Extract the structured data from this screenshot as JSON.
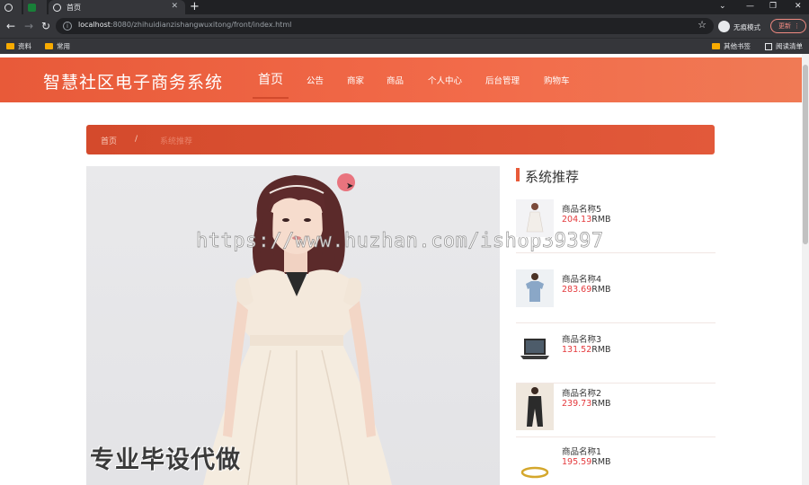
{
  "browser": {
    "tabs": [
      {
        "label": ""
      },
      {
        "label": ""
      },
      {
        "label": "首页"
      }
    ],
    "url_host": "localhost",
    "url_rest": ":8080/zhihuidianzishangwuxitong/front/index.html",
    "incognito_label": "无痕模式",
    "update_label": "更新",
    "bookmarks": [
      {
        "label": "资料"
      },
      {
        "label": "常用"
      }
    ],
    "other_bookmarks": "其他书签",
    "reading_list": "阅读清单"
  },
  "site": {
    "title": "智慧社区电子商务系统",
    "nav": [
      {
        "label": "首页",
        "active": true
      },
      {
        "label": "公告"
      },
      {
        "label": "商家"
      },
      {
        "label": "商品"
      },
      {
        "label": "个人中心"
      },
      {
        "label": "后台管理"
      },
      {
        "label": "购物车"
      }
    ],
    "breadcrumb": {
      "home": "首页",
      "separator": "/",
      "current": "系统推荐"
    },
    "hero_overlay": "专业毕设代做",
    "watermark": "https://www.huzhan.com/ishop39397",
    "recommend": {
      "title": "系统推荐",
      "items": [
        {
          "name": "商品名称5",
          "price": "204.13",
          "unit": "RMB",
          "thumb": "dress-icon"
        },
        {
          "name": "商品名称4",
          "price": "283.69",
          "unit": "RMB",
          "thumb": "tshirt-icon"
        },
        {
          "name": "商品名称3",
          "price": "131.52",
          "unit": "RMB",
          "thumb": "laptop-icon"
        },
        {
          "name": "商品名称2",
          "price": "239.73",
          "unit": "RMB",
          "thumb": "suit-icon"
        },
        {
          "name": "商品名称1",
          "price": "195.59",
          "unit": "RMB",
          "thumb": "ring-icon"
        }
      ]
    }
  },
  "colors": {
    "header": "#f26b4a",
    "breadcrumb": "#d44a2c",
    "price": "#e4393c"
  }
}
